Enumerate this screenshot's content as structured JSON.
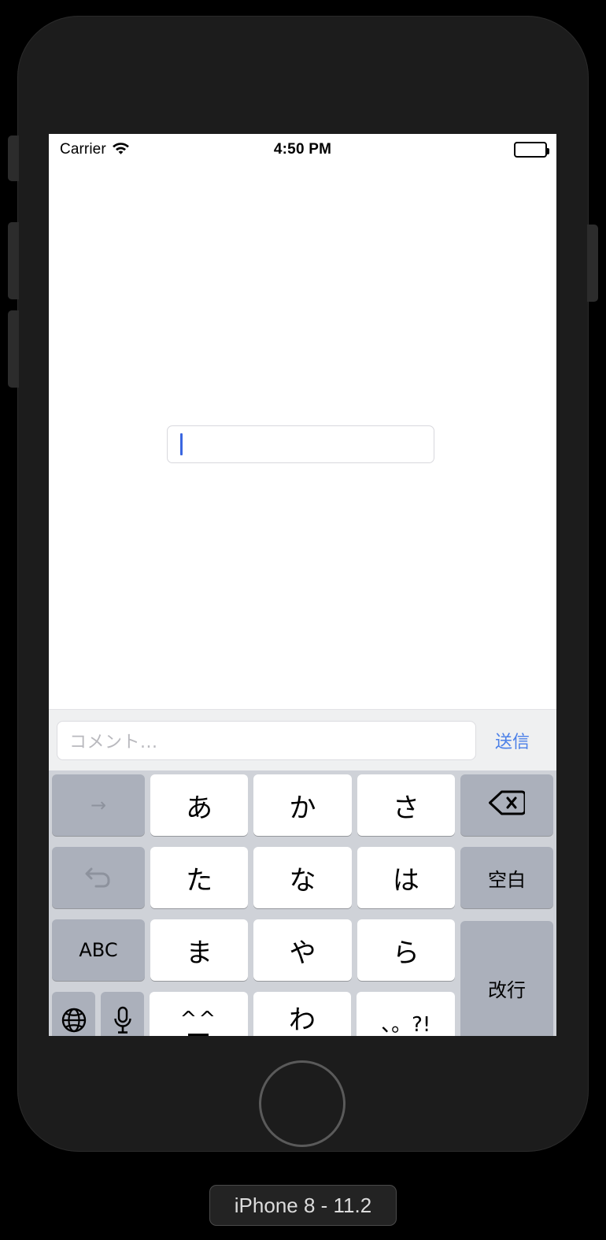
{
  "simulator": {
    "device_label": "iPhone 8 - 11.2"
  },
  "status_bar": {
    "carrier": "Carrier",
    "wifi_icon": "wifi-icon",
    "time": "4:50 PM",
    "battery_icon": "battery-full-icon"
  },
  "content": {
    "text_field_value": "",
    "caret": "text-cursor"
  },
  "accessory_bar": {
    "placeholder": "コメント...",
    "input_value": "",
    "send_label": "送信",
    "send_color": "#4a7fe8"
  },
  "keyboard": {
    "type": "japanese-kana",
    "rows": [
      {
        "keys": [
          {
            "label": "→",
            "name": "next-candidate-key",
            "style": "gray-dim"
          },
          {
            "label": "あ",
            "name": "kana-key-a",
            "style": "white"
          },
          {
            "label": "か",
            "name": "kana-key-ka",
            "style": "white"
          },
          {
            "label": "さ",
            "name": "kana-key-sa",
            "style": "white"
          },
          {
            "label": "",
            "name": "delete-key",
            "style": "gray",
            "icon": "backspace-icon"
          }
        ]
      },
      {
        "keys": [
          {
            "label": "↺",
            "name": "undo-key",
            "style": "gray-dim",
            "icon": "undo-icon"
          },
          {
            "label": "た",
            "name": "kana-key-ta",
            "style": "white"
          },
          {
            "label": "な",
            "name": "kana-key-na",
            "style": "white"
          },
          {
            "label": "は",
            "name": "kana-key-ha",
            "style": "white"
          },
          {
            "label": "空白",
            "name": "space-key",
            "style": "gray"
          }
        ]
      },
      {
        "keys": [
          {
            "label": "ABC",
            "name": "abc-keyboard-key",
            "style": "gray"
          },
          {
            "label": "ま",
            "name": "kana-key-ma",
            "style": "white"
          },
          {
            "label": "や",
            "name": "kana-key-ya",
            "style": "white"
          },
          {
            "label": "ら",
            "name": "kana-key-ra",
            "style": "white"
          }
        ]
      },
      {
        "keys": [
          {
            "label": "",
            "name": "globe-key",
            "style": "gray",
            "icon": "globe-icon"
          },
          {
            "label": "",
            "name": "dictation-key",
            "style": "gray",
            "icon": "microphone-icon"
          },
          {
            "label": "^^",
            "name": "emoticon-key",
            "style": "white"
          },
          {
            "label": "わ",
            "name": "kana-key-wa",
            "style": "white"
          },
          {
            "label": "、。?!",
            "name": "punctuation-key",
            "style": "white"
          }
        ]
      }
    ],
    "return_label": "改行",
    "return_name": "return-key"
  },
  "colors": {
    "keyboard_background": "#cfd2d8",
    "key_white": "#ffffff",
    "key_gray": "#abb0bb",
    "accessory_background": "#eff0f1",
    "accent_blue": "#4a7fe8",
    "caret_blue": "#3a66e0",
    "device_body": "#1c1c1c"
  }
}
